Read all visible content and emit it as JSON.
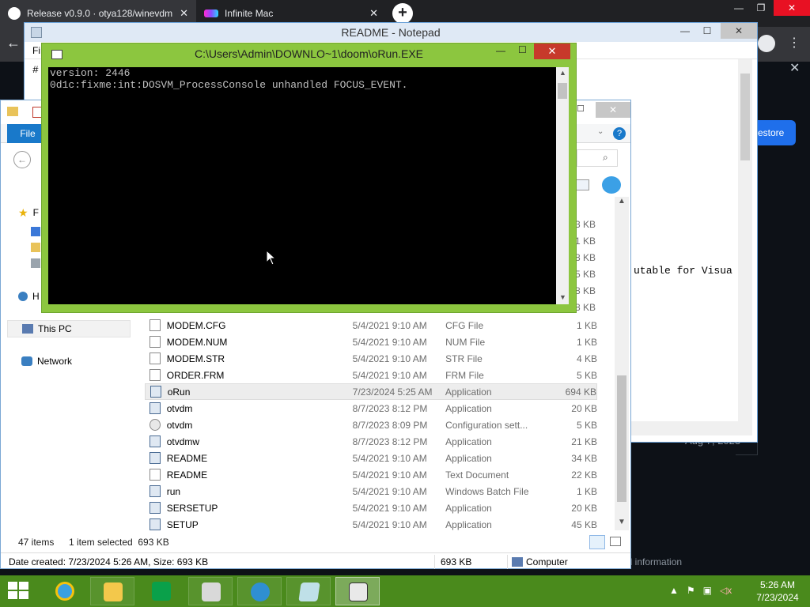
{
  "browser": {
    "tabs": [
      {
        "title": "Release v0.9.0 · otya128/winevdm",
        "icon": "github-icon"
      },
      {
        "title": "Infinite Mac",
        "icon": "infinite-mac-icon"
      }
    ],
    "close_glyph": "✕",
    "new_tab_glyph": "+",
    "min_glyph": "—",
    "max_glyph": "❐",
    "back_glyph": "←",
    "menu_glyph": "⋮",
    "page": {
      "restore_label": "estore",
      "date": "Aug 7, 2023",
      "legal": "al information"
    }
  },
  "notepad": {
    "title": "README - Notepad",
    "menu_file": "Fi",
    "text_hash": "#",
    "text_line": "utable for Visua",
    "close_glyph": "✕",
    "min_glyph": "—",
    "max_glyph": "☐"
  },
  "explorer": {
    "file_tab": "File",
    "help_glyph": "?",
    "expand_glyph": "⌄",
    "back_glyph": "←",
    "search_glyph": "⌕",
    "close_glyph": "✕",
    "max_glyph": "☐",
    "nav": {
      "favorites_partial": "F",
      "homegroup_partial": "H",
      "this_pc": "This PC",
      "network": "Network"
    },
    "partial_sizes": [
      "3 KB",
      "1 KB",
      "8 KB",
      "5 KB",
      "8 KB",
      "8 KB"
    ],
    "files": [
      {
        "name": "MODEM.CFG",
        "date": "5/4/2021 9:10 AM",
        "type": "CFG File",
        "size": "1 KB",
        "icon": "doc"
      },
      {
        "name": "MODEM.NUM",
        "date": "5/4/2021 9:10 AM",
        "type": "NUM File",
        "size": "1 KB",
        "icon": "doc"
      },
      {
        "name": "MODEM.STR",
        "date": "5/4/2021 9:10 AM",
        "type": "STR File",
        "size": "4 KB",
        "icon": "doc"
      },
      {
        "name": "ORDER.FRM",
        "date": "5/4/2021 9:10 AM",
        "type": "FRM File",
        "size": "5 KB",
        "icon": "doc"
      },
      {
        "name": "oRun",
        "date": "7/23/2024 5:25 AM",
        "type": "Application",
        "size": "694 KB",
        "icon": "app",
        "selected": true
      },
      {
        "name": "otvdm",
        "date": "8/7/2023 8:12 PM",
        "type": "Application",
        "size": "20 KB",
        "icon": "app"
      },
      {
        "name": "otvdm",
        "date": "8/7/2023 8:09 PM",
        "type": "Configuration sett...",
        "size": "5 KB",
        "icon": "cfg"
      },
      {
        "name": "otvdmw",
        "date": "8/7/2023 8:12 PM",
        "type": "Application",
        "size": "21 KB",
        "icon": "app"
      },
      {
        "name": "README",
        "date": "5/4/2021 9:10 AM",
        "type": "Application",
        "size": "34 KB",
        "icon": "app"
      },
      {
        "name": "README",
        "date": "5/4/2021 9:10 AM",
        "type": "Text Document",
        "size": "22 KB",
        "icon": "doc"
      },
      {
        "name": "run",
        "date": "5/4/2021 9:10 AM",
        "type": "Windows Batch File",
        "size": "1 KB",
        "icon": "bat"
      },
      {
        "name": "SERSETUP",
        "date": "5/4/2021 9:10 AM",
        "type": "Application",
        "size": "20 KB",
        "icon": "app"
      },
      {
        "name": "SETUP",
        "date": "5/4/2021 9:10 AM",
        "type": "Application",
        "size": "45 KB",
        "icon": "app"
      }
    ],
    "status": {
      "items": "47 items",
      "selected": "1 item selected  693 KB"
    },
    "info": {
      "dates": "Date created: 7/23/2024 5:26 AM, Size: 693 KB",
      "size": "693 KB",
      "computer": "Computer"
    },
    "scroll_up": "▲",
    "scroll_down": "▼"
  },
  "console": {
    "title": "C:\\Users\\Admin\\DOWNLO~1\\doom\\oRun.EXE",
    "lines": [
      "version: 2446",
      "0d1c:fixme:int:DOSVM_ProcessConsole unhandled FOCUS_EVENT."
    ],
    "close_glyph": "✕",
    "min_glyph": "—",
    "max_glyph": "☐",
    "scroll_up": "▲",
    "scroll_down": "▼"
  },
  "taskbar": {
    "tray_glyphs": [
      "▲",
      "⚑",
      "▣",
      "◁x"
    ],
    "time": "5:26 AM",
    "date": "7/23/2024"
  },
  "colors": {
    "console_frame": "#8cc63f",
    "taskbar": "#4a8a1c",
    "explorer_accent": "#1979ca",
    "console_close": "#c7392b"
  }
}
